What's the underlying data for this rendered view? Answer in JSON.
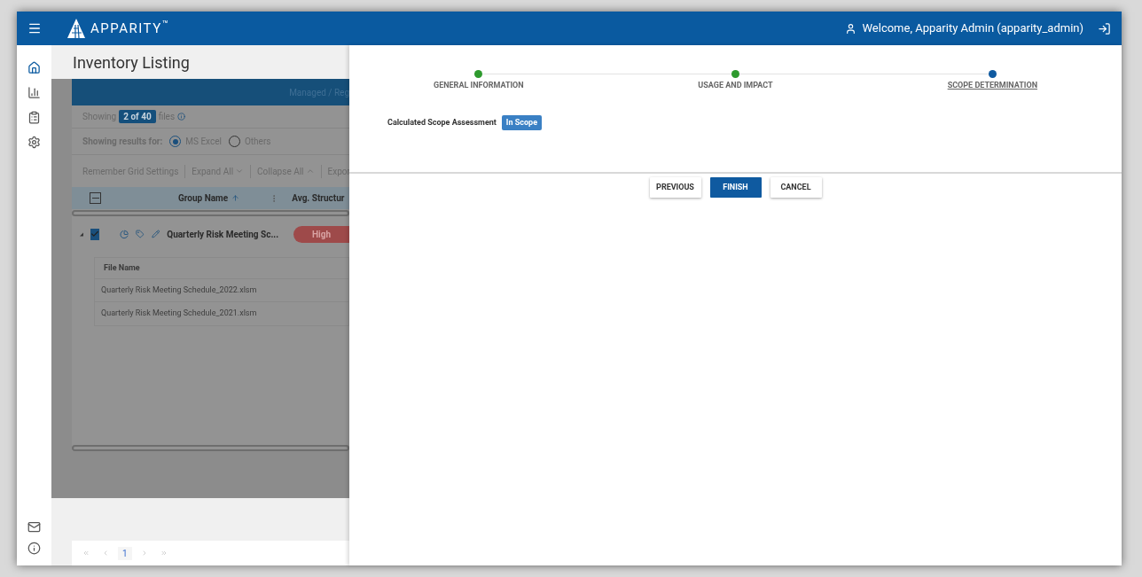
{
  "header": {
    "brand": "APPARITY$^{™}$",
    "welcome": "Welcome, Apparity Admin (apparity_admin)"
  },
  "page": {
    "title": "Inventory Listing",
    "banner": "Managed / Reg",
    "count": {
      "prefix": "Showing",
      "badge": "2 of 40",
      "suffix": "files"
    },
    "filter": {
      "label": "Showing results for:",
      "options": [
        {
          "label": "MS Excel",
          "selected": true
        },
        {
          "label": "Others",
          "selected": false
        }
      ]
    },
    "toolbar": [
      {
        "label": "Remember Grid Settings",
        "kind": "plain"
      },
      {
        "label": "Expand All",
        "kind": "down"
      },
      {
        "label": "Collapse All",
        "kind": "up"
      },
      {
        "label": "Expor",
        "kind": "plain"
      }
    ],
    "select_all": {
      "indeterminate": true
    },
    "columns": [
      "Group Name",
      "Avg. Structur"
    ],
    "row": {
      "checked": true,
      "name": "Quarterly Risk Meeting Sc...",
      "risk": "High"
    },
    "files": {
      "column": "File Name",
      "rows": [
        "Quarterly Risk Meeting Schedule_2022.xlsm",
        "Quarterly Risk Meeting Schedule_2021.xlsm"
      ]
    },
    "pagination": [
      {
        "label": "1",
        "selected": true
      }
    ]
  },
  "wizard": {
    "steps": [
      {
        "label": "GENERAL INFORMATION",
        "completed": true,
        "selected": false
      },
      {
        "label": "USAGE AND IMPACT",
        "completed": true,
        "selected": false
      },
      {
        "label": "SCOPE DETERMINATION",
        "completed": false,
        "selected": true
      }
    ],
    "assessment": {
      "label": "Calculated Scope Assessment",
      "badge": "In Scope"
    },
    "buttons": [
      {
        "label": "PREVIOUS",
        "kind": "secondary"
      },
      {
        "label": "FINISH",
        "kind": "primary"
      },
      {
        "label": "CANCEL",
        "kind": "secondary"
      }
    ]
  }
}
